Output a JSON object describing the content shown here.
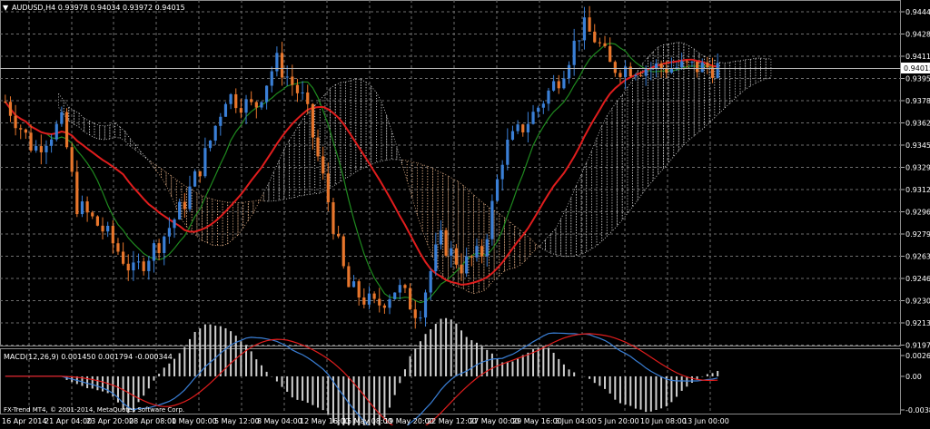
{
  "header": {
    "symbol_line": "AUDUSD,H4  0.93978 0.94034 0.93972 0.94015",
    "dropdown_glyph": "▼"
  },
  "price_panel": {
    "y_ticks": [
      "0.94445",
      "0.94280",
      "0.94115",
      "0.93950",
      "0.93785",
      "0.93620",
      "0.93455",
      "0.93290",
      "0.93125",
      "0.92960",
      "0.92795",
      "0.92630",
      "0.92465",
      "0.92300",
      "0.92135",
      "0.91970"
    ],
    "current_price": "0.94015"
  },
  "macd_panel": {
    "label": "MACD(12,26,9) 0.001450 0.001794 -0.000344",
    "y_ticks": [
      "0.002654",
      "0.00",
      "-0.003803"
    ],
    "footer": "FX-Trend MT4, © 2001-2014, MetaQuotes Software Corp."
  },
  "time_axis": {
    "labels": [
      "16 Apr 2014",
      "21 Apr 04:00",
      "23 Apr 20:00",
      "28 Apr 08:00",
      "1 May 00:00",
      "5 May 12:00",
      "8 May 04:00",
      "12 May 16:00",
      "15 May 08:00",
      "19 May 20:00",
      "22 May 12:00",
      "27 May 00:00",
      "29 May 16:00",
      "3 Jun 04:00",
      "5 Jun 20:00",
      "10 Jun 08:00",
      "13 Jun 00:00"
    ]
  },
  "colors": {
    "background": "#000000",
    "grid": "#6e6e6e",
    "bull_candle": "#3a7fd6",
    "bear_candle": "#e8762c",
    "ma_slow": "#e01d1d",
    "ma_fast": "#1f8a1f",
    "cloud_bear": "#e8b48a",
    "cloud_bull": "#d8d8d8",
    "macd_line": "#3a7fd6",
    "signal_line": "#e01d1d"
  },
  "chart_data": {
    "type": "candlestick",
    "symbol": "AUDUSD",
    "timeframe": "H4",
    "ylim": [
      0.9197,
      0.94445
    ],
    "last_quote": {
      "open": 0.93978,
      "high": 0.94034,
      "low": 0.93972,
      "close": 0.94015
    },
    "macd": {
      "params": "12,26,9",
      "main": 0.00145,
      "signal": 0.001794,
      "histogram": -0.000344,
      "ylim": [
        -0.003803,
        0.002654
      ]
    },
    "close_path": [
      [
        0,
        0.9375
      ],
      [
        0.04,
        0.934
      ],
      [
        0.08,
        0.936
      ],
      [
        0.1,
        0.93
      ],
      [
        0.14,
        0.928
      ],
      [
        0.18,
        0.925
      ],
      [
        0.22,
        0.9275
      ],
      [
        0.25,
        0.93
      ],
      [
        0.28,
        0.9335
      ],
      [
        0.31,
        0.938
      ],
      [
        0.35,
        0.937
      ],
      [
        0.38,
        0.9405
      ],
      [
        0.42,
        0.9375
      ],
      [
        0.45,
        0.931
      ],
      [
        0.48,
        0.924
      ],
      [
        0.52,
        0.9225
      ],
      [
        0.55,
        0.924
      ],
      [
        0.58,
        0.922
      ],
      [
        0.61,
        0.9275
      ],
      [
        0.64,
        0.9255
      ],
      [
        0.67,
        0.9265
      ],
      [
        0.7,
        0.934
      ],
      [
        0.74,
        0.9365
      ],
      [
        0.78,
        0.9395
      ],
      [
        0.81,
        0.943
      ],
      [
        0.83,
        0.942
      ],
      [
        0.85,
        0.94
      ]
    ]
  }
}
